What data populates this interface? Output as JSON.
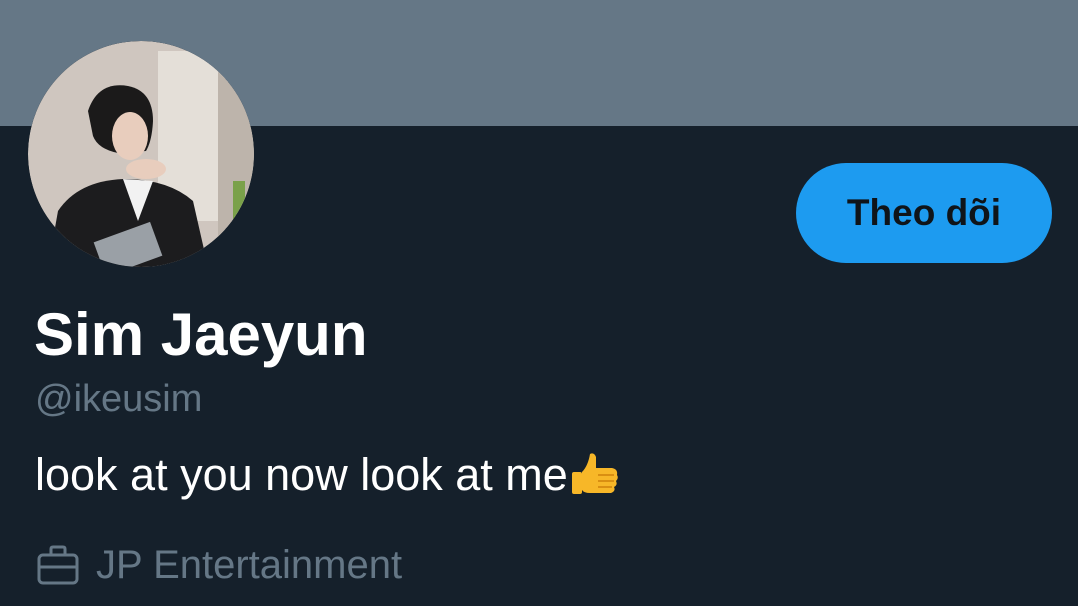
{
  "profile": {
    "display_name": "Sim Jaeyun",
    "handle": "@ikeusim",
    "bio_text": "look at you now look at me",
    "bio_emoji": "thumbs-up-icon",
    "work": "JP Entertainment",
    "work_icon": "briefcase-icon"
  },
  "actions": {
    "follow_label": "Theo dõi"
  },
  "colors": {
    "banner": "#657786",
    "background": "#15202b",
    "accent": "#1d9bf0",
    "secondary_text": "#657786"
  }
}
